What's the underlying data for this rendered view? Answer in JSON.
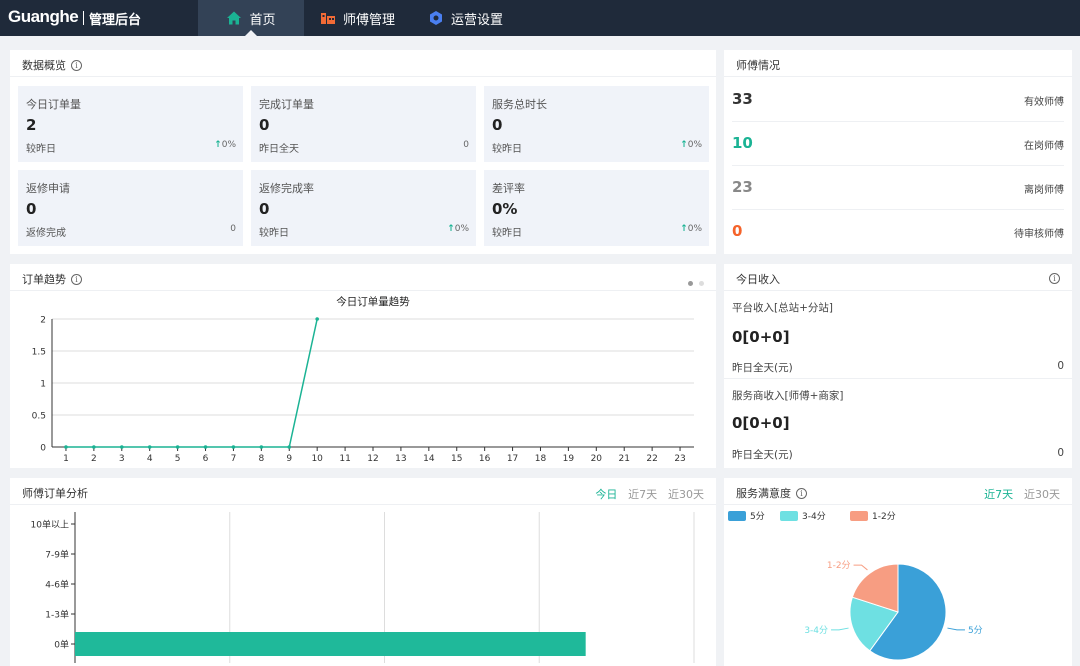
{
  "header": {
    "logo": "Guanghe",
    "subtitle": "管理后台",
    "nav": [
      {
        "label": "首页",
        "icon": "home-icon",
        "active": true
      },
      {
        "label": "师傅管理",
        "icon": "worker-icon",
        "active": false
      },
      {
        "label": "运营设置",
        "icon": "settings-icon",
        "active": false
      }
    ]
  },
  "overview": {
    "title": "数据概览",
    "cards": [
      {
        "label": "今日订单量",
        "value": "2",
        "foot": "较昨日",
        "delta": "0%",
        "arrow": true
      },
      {
        "label": "完成订单量",
        "value": "0",
        "foot": "昨日全天",
        "delta": "0",
        "arrow": false
      },
      {
        "label": "服务总时长",
        "value": "0",
        "foot": "较昨日",
        "delta": "0%",
        "arrow": true
      },
      {
        "label": "返修申请",
        "value": "0",
        "foot": "返修完成",
        "delta": "0",
        "arrow": false
      },
      {
        "label": "返修完成率",
        "value": "0",
        "foot": "较昨日",
        "delta": "0%",
        "arrow": true
      },
      {
        "label": "差评率",
        "value": "0%",
        "foot": "较昨日",
        "delta": "0%",
        "arrow": true
      }
    ]
  },
  "masters": {
    "title": "师傅情况",
    "rows": [
      {
        "value": "33",
        "label": "有效师傅",
        "color": "#333333"
      },
      {
        "value": "10",
        "label": "在岗师傅",
        "color": "#1bb394"
      },
      {
        "value": "23",
        "label": "离岗师傅",
        "color": "#888888"
      },
      {
        "value": "0",
        "label": "待审核师傅",
        "color": "#f5632a"
      }
    ]
  },
  "trend": {
    "title": "订单趋势"
  },
  "income": {
    "title": "今日收入",
    "platform_label": "平台收入[总站+分站]",
    "platform_value": "0[0+0]",
    "platform_foot": "昨日全天(元)",
    "platform_foot_value": "0",
    "service_label": "服务商收入[师傅+商家]",
    "service_value": "0[0+0]",
    "service_foot": "昨日全天(元)",
    "service_foot_value": "0"
  },
  "analysis": {
    "title": "师傅订单分析",
    "tabs": [
      "今日",
      "近7天",
      "近30天"
    ]
  },
  "satisfaction": {
    "title": "服务满意度",
    "tabs": [
      "近7天",
      "近30天"
    ]
  },
  "chart_data": [
    {
      "type": "line",
      "title": "今日订单量趋势",
      "x": [
        "1",
        "2",
        "3",
        "4",
        "5",
        "6",
        "7",
        "8",
        "9",
        "10",
        "11",
        "12",
        "13",
        "14",
        "15",
        "16",
        "17",
        "18",
        "19",
        "20",
        "21",
        "22",
        "23"
      ],
      "series": [
        {
          "values": [
            0,
            0,
            0,
            0,
            0,
            0,
            0,
            0,
            0,
            2,
            null,
            null,
            null,
            null,
            null,
            null,
            null,
            null,
            null,
            null,
            null,
            null,
            null
          ],
          "color": "#1bb394"
        }
      ],
      "ylim": [
        0,
        2
      ],
      "yticks": [
        "0",
        "0.5",
        "1",
        "1.5",
        "2"
      ],
      "grid": true
    },
    {
      "type": "bar",
      "orientation": "horizontal",
      "categories": [
        "0单",
        "1-3单",
        "4-6单",
        "7-9单",
        "10单以上"
      ],
      "values": [
        33,
        0,
        0,
        0,
        0
      ],
      "color": "#1fb99a"
    },
    {
      "type": "pie",
      "legend": [
        "5分",
        "3-4分",
        "1-2分"
      ],
      "values": [
        60,
        20,
        20
      ],
      "colors": [
        "#3aa0d8",
        "#6ee0e2",
        "#f79d82"
      ],
      "legend_position": "top-left"
    }
  ]
}
